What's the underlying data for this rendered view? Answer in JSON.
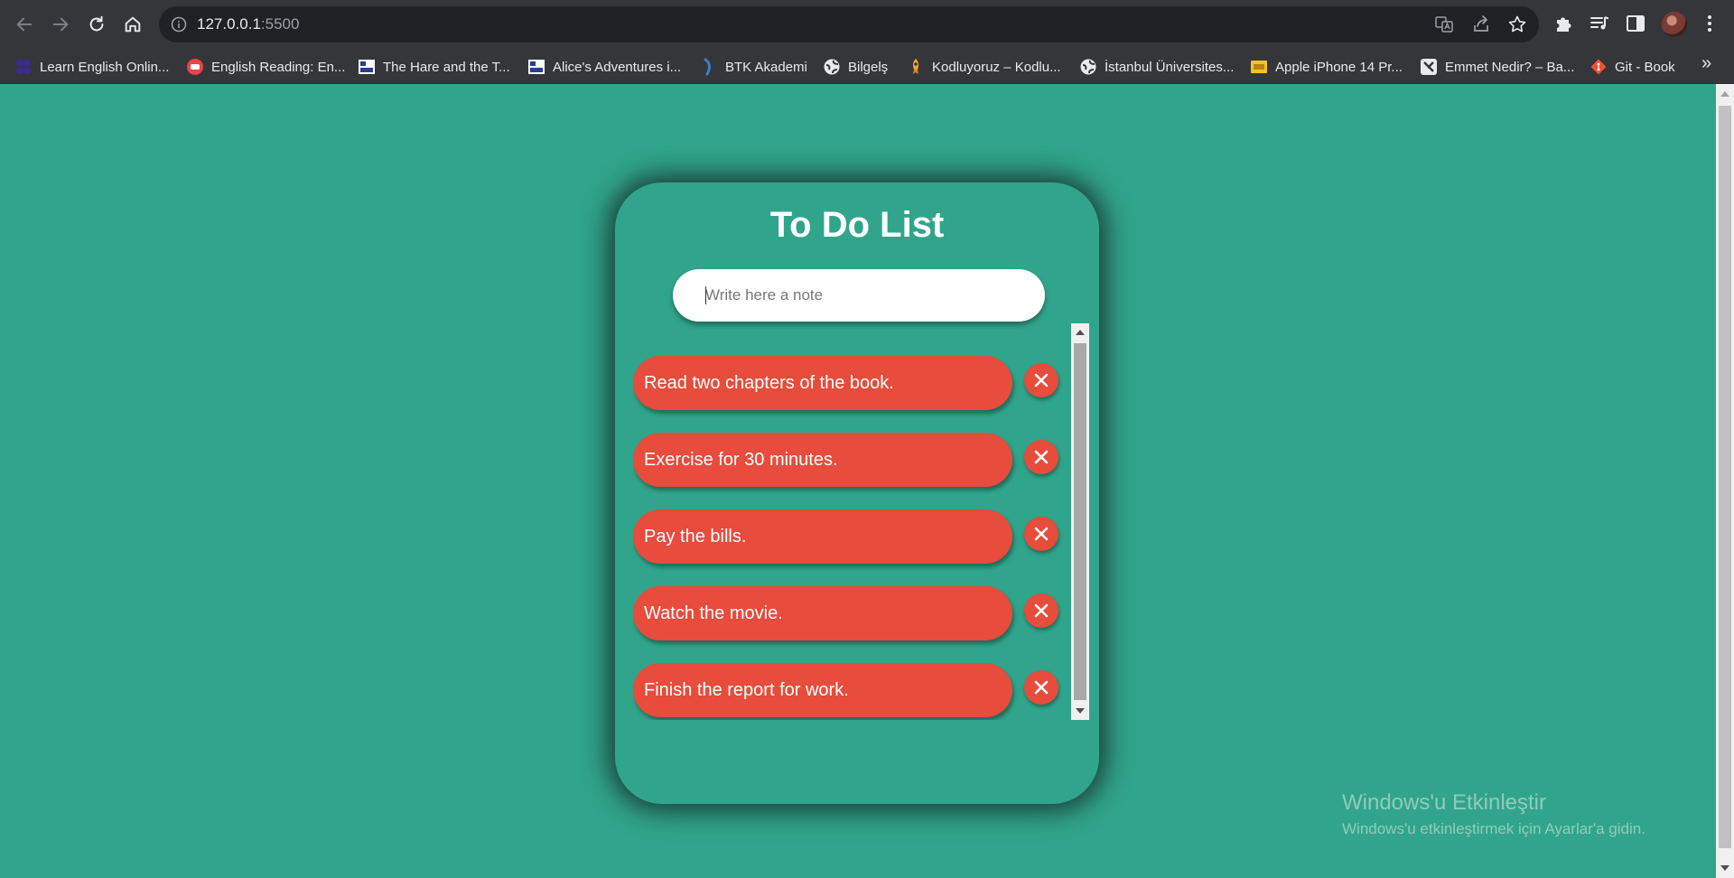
{
  "browser": {
    "url_host": "127.0.0.1",
    "url_port": ":5500",
    "bookmarks": [
      {
        "label": "Learn English Onlin...",
        "icon": "purple-dots-icon"
      },
      {
        "label": "English Reading: En...",
        "icon": "red-speech-icon"
      },
      {
        "label": "The Hare and the T...",
        "icon": "book-site-icon"
      },
      {
        "label": "Alice's Adventures i...",
        "icon": "book-site-icon"
      },
      {
        "label": "BTK Akademi",
        "icon": "btk-icon"
      },
      {
        "label": "Bilgelş",
        "icon": "globe-icon"
      },
      {
        "label": "Kodluyoruz – Kodlu...",
        "icon": "rocket-icon"
      },
      {
        "label": "İstanbul Üniversites...",
        "icon": "globe-icon"
      },
      {
        "label": "Apple iPhone 14 Pr...",
        "icon": "yellow-site-icon"
      },
      {
        "label": "Emmet Nedir? – Ba...",
        "icon": "emmet-icon"
      },
      {
        "label": "Git - Book",
        "icon": "git-icon"
      }
    ],
    "more_label": "»"
  },
  "app": {
    "title": "To Do List",
    "input_placeholder": "Write here a note",
    "todos": [
      {
        "text": "Read two chapters of the book."
      },
      {
        "text": "Exercise for 30 minutes."
      },
      {
        "text": "Pay the bills."
      },
      {
        "text": "Watch the movie."
      },
      {
        "text": "Finish the report for work."
      }
    ]
  },
  "watermark": {
    "title": "Windows'u Etkinleştir",
    "subtitle": "Windows'u etkinleştirmek için Ayarlar'a gidin."
  },
  "colors": {
    "page_background": "#31a58b",
    "todo_red": "#e74c3c",
    "chrome_dark": "#35363a"
  }
}
